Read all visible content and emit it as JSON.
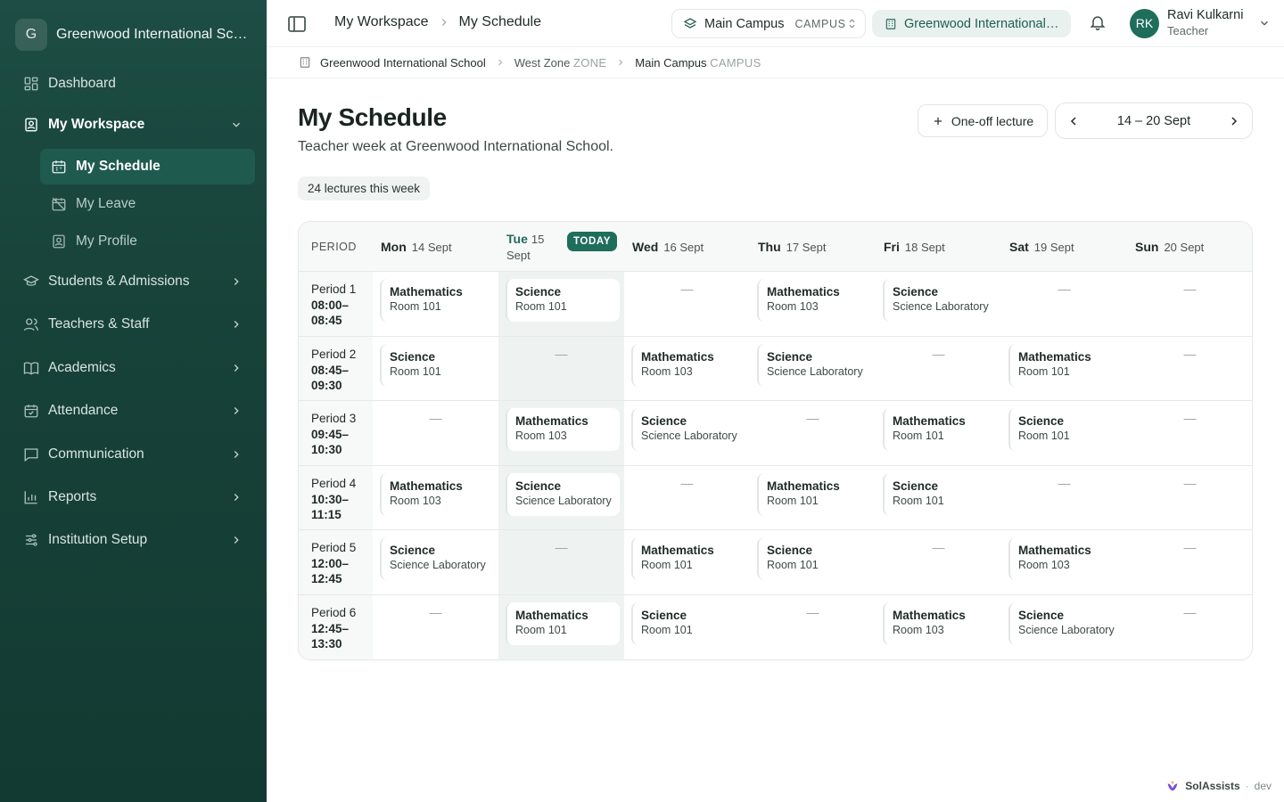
{
  "sidebar": {
    "logo_letter": "G",
    "org_name": "Greenwood International School",
    "items": [
      {
        "label": "Dashboard"
      },
      {
        "label": "My Workspace"
      },
      {
        "label": "Students & Admissions"
      },
      {
        "label": "Teachers & Staff"
      },
      {
        "label": "Academics"
      },
      {
        "label": "Attendance"
      },
      {
        "label": "Communication"
      },
      {
        "label": "Reports"
      },
      {
        "label": "Institution Setup"
      }
    ],
    "workspace_items": [
      {
        "label": "My Schedule"
      },
      {
        "label": "My Leave"
      },
      {
        "label": "My Profile"
      }
    ]
  },
  "topbar": {
    "breadcrumb": [
      "My Workspace",
      "My Schedule"
    ],
    "campus_name": "Main Campus",
    "campus_tag": "CAMPUS",
    "school": "Greenwood International School",
    "user_initials": "RK",
    "user_name": "Ravi Kulkarni",
    "user_role": "Teacher"
  },
  "subbar": {
    "school": "Greenwood International School",
    "zone": "West Zone",
    "zone_kind": "ZONE",
    "campus": "Main Campus",
    "campus_kind": "CAMPUS"
  },
  "main": {
    "title": "My Schedule",
    "subtitle": "Teacher week at Greenwood International School.",
    "count_label": "24 lectures this week",
    "oneoff_label": "One-off lecture",
    "week_range": "14 – 20 Sept"
  },
  "schedule": {
    "period_header": "PERIOD",
    "today_tag": "TODAY",
    "empty_mark": "—",
    "days": [
      {
        "day": "Mon",
        "date": "14 Sept"
      },
      {
        "day": "Tue",
        "date": "15 Sept"
      },
      {
        "day": "Wed",
        "date": "16 Sept"
      },
      {
        "day": "Thu",
        "date": "17 Sept"
      },
      {
        "day": "Fri",
        "date": "18 Sept"
      },
      {
        "day": "Sat",
        "date": "19 Sept"
      },
      {
        "day": "Sun",
        "date": "20 Sept"
      }
    ],
    "today_index": 1,
    "periods": [
      {
        "label": "Period 1",
        "time": "08:00–08:45",
        "cells": [
          {
            "subject": "Mathematics",
            "room": "Room 101"
          },
          {
            "subject": "Science",
            "room": "Room 101"
          },
          null,
          {
            "subject": "Mathematics",
            "room": "Room 103"
          },
          {
            "subject": "Science",
            "room": "Science Laboratory"
          },
          null,
          null
        ]
      },
      {
        "label": "Period 2",
        "time": "08:45–09:30",
        "cells": [
          {
            "subject": "Science",
            "room": "Room 101"
          },
          null,
          {
            "subject": "Mathematics",
            "room": "Room 103"
          },
          {
            "subject": "Science",
            "room": "Science Laboratory"
          },
          null,
          {
            "subject": "Mathematics",
            "room": "Room 101"
          },
          null
        ]
      },
      {
        "label": "Period 3",
        "time": "09:45–10:30",
        "cells": [
          null,
          {
            "subject": "Mathematics",
            "room": "Room 103"
          },
          {
            "subject": "Science",
            "room": "Science Laboratory"
          },
          null,
          {
            "subject": "Mathematics",
            "room": "Room 101"
          },
          {
            "subject": "Science",
            "room": "Room 101"
          },
          null
        ]
      },
      {
        "label": "Period 4",
        "time": "10:30–11:15",
        "cells": [
          {
            "subject": "Mathematics",
            "room": "Room 103"
          },
          {
            "subject": "Science",
            "room": "Science Laboratory"
          },
          null,
          {
            "subject": "Mathematics",
            "room": "Room 101"
          },
          {
            "subject": "Science",
            "room": "Room 101"
          },
          null,
          null
        ]
      },
      {
        "label": "Period 5",
        "time": "12:00–12:45",
        "cells": [
          {
            "subject": "Science",
            "room": "Science Laboratory"
          },
          null,
          {
            "subject": "Mathematics",
            "room": "Room 101"
          },
          {
            "subject": "Science",
            "room": "Room 101"
          },
          null,
          {
            "subject": "Mathematics",
            "room": "Room 103"
          },
          null
        ]
      },
      {
        "label": "Period 6",
        "time": "12:45–13:30",
        "cells": [
          null,
          {
            "subject": "Mathematics",
            "room": "Room 101"
          },
          {
            "subject": "Science",
            "room": "Room 101"
          },
          null,
          {
            "subject": "Mathematics",
            "room": "Room 103"
          },
          {
            "subject": "Science",
            "room": "Science Laboratory"
          },
          null
        ]
      }
    ]
  },
  "footer": {
    "brand": "SolAssists",
    "separator": "·",
    "env": "dev"
  },
  "colors": {
    "sidebar_bg": "#174239",
    "accent": "#1f6d5b",
    "today_col": "#eef3f1"
  }
}
